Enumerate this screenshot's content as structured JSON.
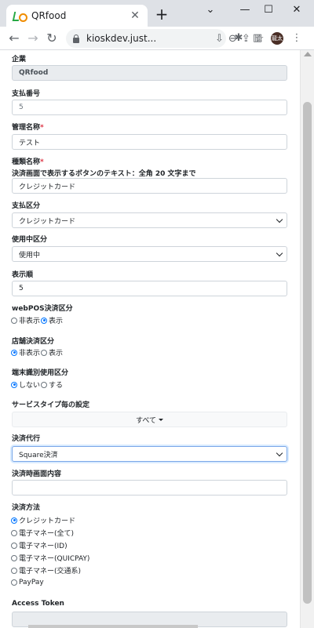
{
  "browser": {
    "tab_title": "QRfood",
    "url": "kioskdev.just...",
    "avatar_text": "龍太"
  },
  "form": {
    "company": {
      "label": "企業",
      "value": "QRfood"
    },
    "payment_number": {
      "label": "支払番号",
      "placeholder": "5"
    },
    "admin_name": {
      "label": "管理名称",
      "required": "*",
      "value": "テスト"
    },
    "type_name": {
      "label": "種類名称",
      "required": "*",
      "hint": "決済画面で表示するボタンのテキスト：全角 20 文字まで",
      "value": "クレジットカード"
    },
    "payment_category": {
      "label": "支払区分",
      "value": "クレジットカード"
    },
    "usage_status": {
      "label": "使用中区分",
      "value": "使用中"
    },
    "display_order": {
      "label": "表示順",
      "value": "5"
    },
    "webpos": {
      "label": "webPOS決済区分",
      "options": [
        "非表示",
        "表示"
      ],
      "selected": "表示"
    },
    "store": {
      "label": "店舗決済区分",
      "options": [
        "非表示",
        "表示"
      ],
      "selected": "非表示"
    },
    "terminal": {
      "label": "端末識別使用区分",
      "options": [
        "しない",
        "する"
      ],
      "selected": "しない"
    },
    "service_type": {
      "label": "サービスタイプ毎の設定",
      "button": "すべて"
    },
    "agency": {
      "label": "決済代行",
      "value": "Square決済"
    },
    "screen_content": {
      "label": "決済時画面内容",
      "value": ""
    },
    "method": {
      "label": "決済方法",
      "options": [
        "クレジットカード",
        "電子マネー(全て)",
        "電子マネー(ID)",
        "電子マネー(QUICPAY)",
        "電子マネー(交通系)",
        "PayPay"
      ],
      "selected": "クレジットカード"
    },
    "access_token": {
      "label": "Access Token"
    }
  }
}
